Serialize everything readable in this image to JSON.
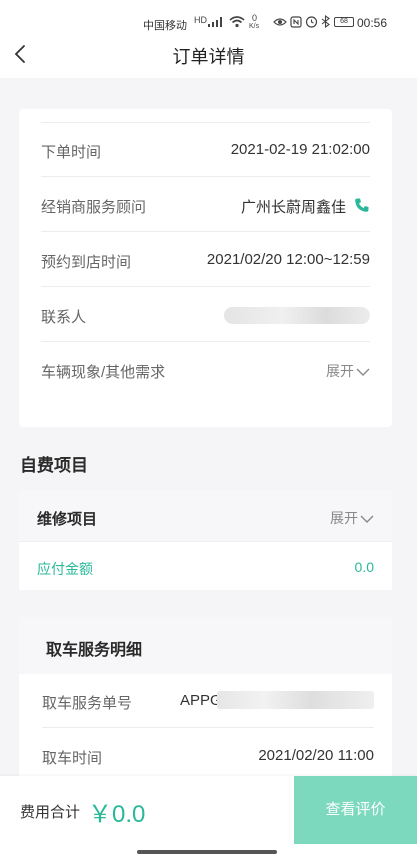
{
  "status_bar": {
    "carrier": "中国移动",
    "network_badge": "HD",
    "speed_top": "0",
    "speed_unit": "K/s",
    "battery": "68",
    "time": "00:56"
  },
  "header": {
    "title": "订单详情"
  },
  "order_info": {
    "rows": [
      {
        "label": "下单时间",
        "value": "2021-02-19 21:02:00"
      },
      {
        "label": "经销商服务顾问",
        "value": "广州长蔚周鑫佳"
      },
      {
        "label": "预约到店时间",
        "value": "2021/02/20 12:00~12:59"
      },
      {
        "label": "联系人",
        "value": ""
      },
      {
        "label": "车辆现象/其他需求",
        "expand": "展开"
      }
    ]
  },
  "self_pay": {
    "section_title": "自费项目",
    "repair_label": "维修项目",
    "repair_expand": "展开",
    "payable_label": "应付金额",
    "payable_value": "0.0"
  },
  "pickup": {
    "title": "取车服务明细",
    "order_no_label": "取车服务单号",
    "order_no_value": "APPG",
    "time_label": "取车时间",
    "time_value": "2021/02/20 11:00"
  },
  "bottom": {
    "total_label": "费用合计",
    "total_value": "￥0.0",
    "review_label": "查看评价"
  },
  "colors": {
    "accent": "#2bb89a",
    "button": "#7dd9bd",
    "phone": "#2bb89a"
  }
}
